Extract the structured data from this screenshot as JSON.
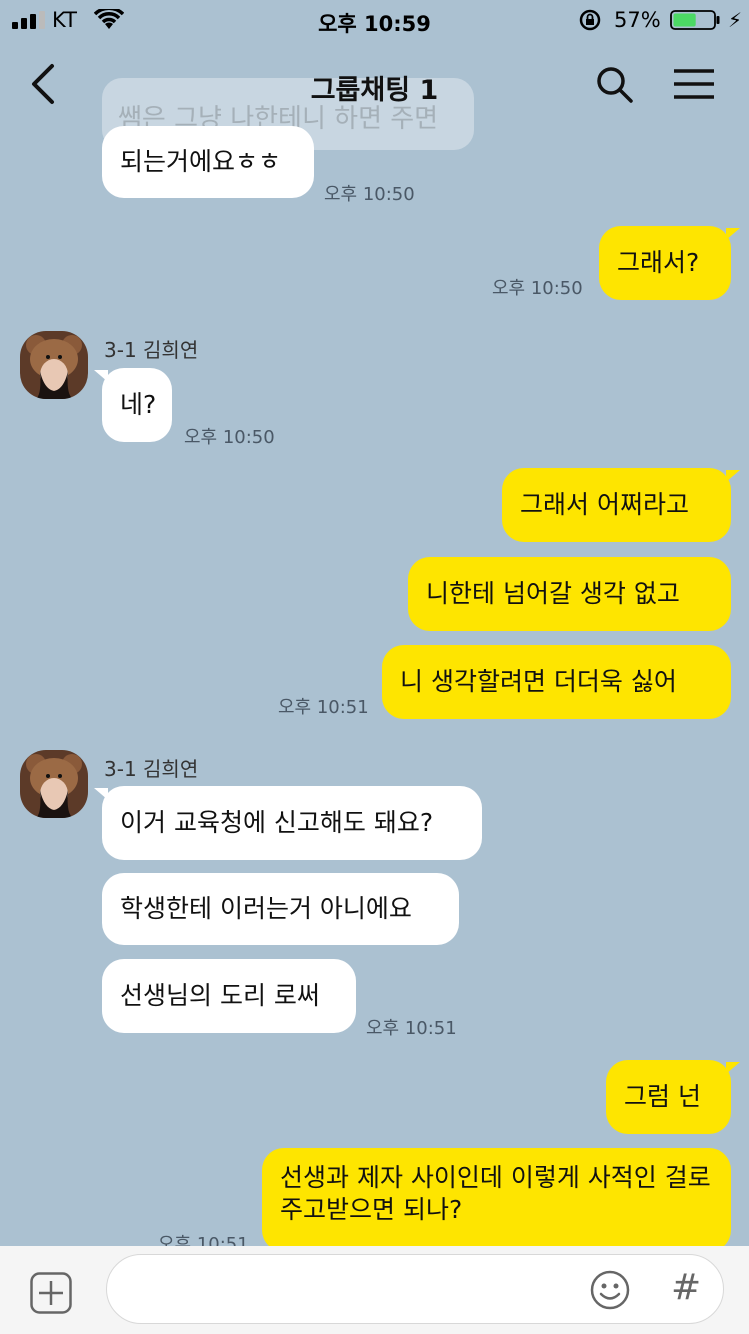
{
  "status_bar": {
    "carrier": "KT",
    "time": "오후 10:59",
    "battery_percent": "57%",
    "battery_level": 0.57
  },
  "header": {
    "title": "그룹채팅 1",
    "ghost_text": "쌤은 그냥 나한테니 하면 주면"
  },
  "messages": [
    {
      "side": "in",
      "text": "되는거에요ㅎㅎ",
      "time": "오후 10:50"
    },
    {
      "side": "out",
      "text": "그래서?",
      "time": "오후 10:50"
    },
    {
      "side": "in",
      "sender": "3-1 김희연",
      "text": "네?",
      "time": "오후 10:50"
    },
    {
      "side": "out",
      "text": "그래서 어쩌라고"
    },
    {
      "side": "out",
      "text": "니한테 넘어갈 생각 없고"
    },
    {
      "side": "out",
      "text": "니 생각할려면 더더욱 싫어",
      "time": "오후 10:51"
    },
    {
      "side": "in",
      "sender": "3-1 김희연",
      "text": "이거 교육청에 신고해도 돼요?"
    },
    {
      "side": "in",
      "text": "학생한테 이러는거 아니에요"
    },
    {
      "side": "in",
      "text": "선생님의 도리 로써",
      "time": "오후 10:51"
    },
    {
      "side": "out",
      "text": "그럼 넌"
    },
    {
      "side": "out",
      "text": "선생과 제자 사이인데 이렇게 사적인 걸로 주고받으면 되나?",
      "time": "오후 10:51"
    }
  ],
  "input_bar": {
    "placeholder": "",
    "hash_label": "#"
  },
  "colors": {
    "background": "#abc1d1",
    "my_bubble": "#fee500",
    "their_bubble": "#ffffff",
    "battery_fill": "#4cd964"
  },
  "icons": [
    "back-arrow-icon",
    "search-icon",
    "menu-icon",
    "plus-icon",
    "emoji-icon",
    "wifi-icon",
    "lock-rotation-icon",
    "battery-icon",
    "charging-bolt-icon"
  ]
}
